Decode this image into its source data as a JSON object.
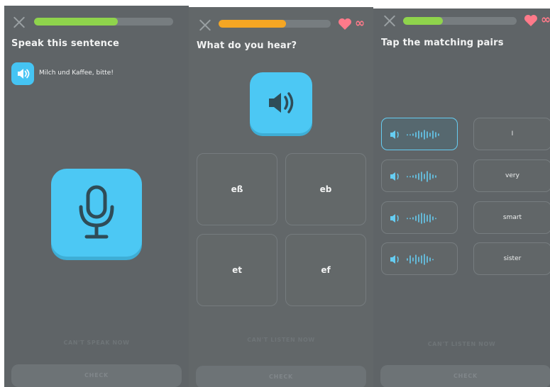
{
  "colors": {
    "background": "#5f6467",
    "accent_blue": "#4cc8f4",
    "progress_green": "#8fd44c",
    "progress_orange": "#f5a623",
    "heart_red": "#ff7a8a"
  },
  "screens": [
    {
      "title": "Speak this sentence",
      "progress": 0.6,
      "sentence": "Milch und Kaffee, bitte!",
      "cant_label": "CAN'T SPEAK NOW",
      "check_label": "CHECK"
    },
    {
      "title": "What do you hear?",
      "progress": 0.6,
      "lives": "∞",
      "options": [
        "eß",
        "eb",
        "et",
        "ef"
      ],
      "cant_label": "CAN'T LISTEN NOW",
      "check_label": "CHECK"
    },
    {
      "title": "Tap the matching pairs",
      "progress": 0.35,
      "lives": "∞",
      "words": [
        "I",
        "very",
        "smart",
        "sister"
      ],
      "cant_label": "CAN'T LISTEN NOW",
      "check_label": "CHECK"
    }
  ],
  "icons": [
    "close-icon",
    "heart-icon",
    "speaker-icon",
    "microphone-icon",
    "waveform-icon"
  ]
}
